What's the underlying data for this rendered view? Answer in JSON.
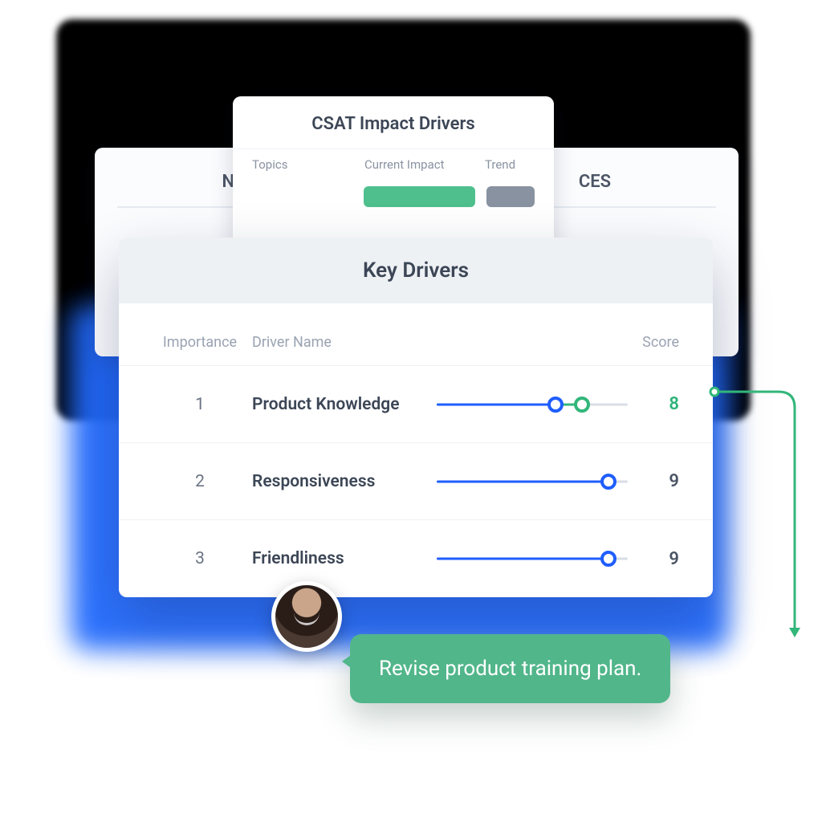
{
  "cards": {
    "nps": {
      "title": "NPS"
    },
    "ces": {
      "title": "CES"
    },
    "csat": {
      "title": "CSAT Impact Drivers",
      "columns": {
        "c1": "Topics",
        "c2": "Current Impact",
        "c3": "Trend"
      }
    }
  },
  "key_drivers": {
    "title": "Key Drivers",
    "columns": {
      "importance": "Importance",
      "driver": "Driver Name",
      "score": "Score"
    },
    "rows": [
      {
        "rank": "1",
        "name": "Product Knowledge",
        "score": "8",
        "highlight": true,
        "slider": {
          "blue_pct": 62,
          "green_pct": 76
        }
      },
      {
        "rank": "2",
        "name": "Responsiveness",
        "score": "9",
        "highlight": false,
        "slider": {
          "blue_pct": 90
        }
      },
      {
        "rank": "3",
        "name": "Friendliness",
        "score": "9",
        "highlight": false,
        "slider": {
          "blue_pct": 90
        }
      }
    ]
  },
  "chat": {
    "text": "Revise product training plan."
  },
  "colors": {
    "blue": "#1f5eff",
    "green": "#32b67a",
    "bubble": "#51b68a"
  }
}
